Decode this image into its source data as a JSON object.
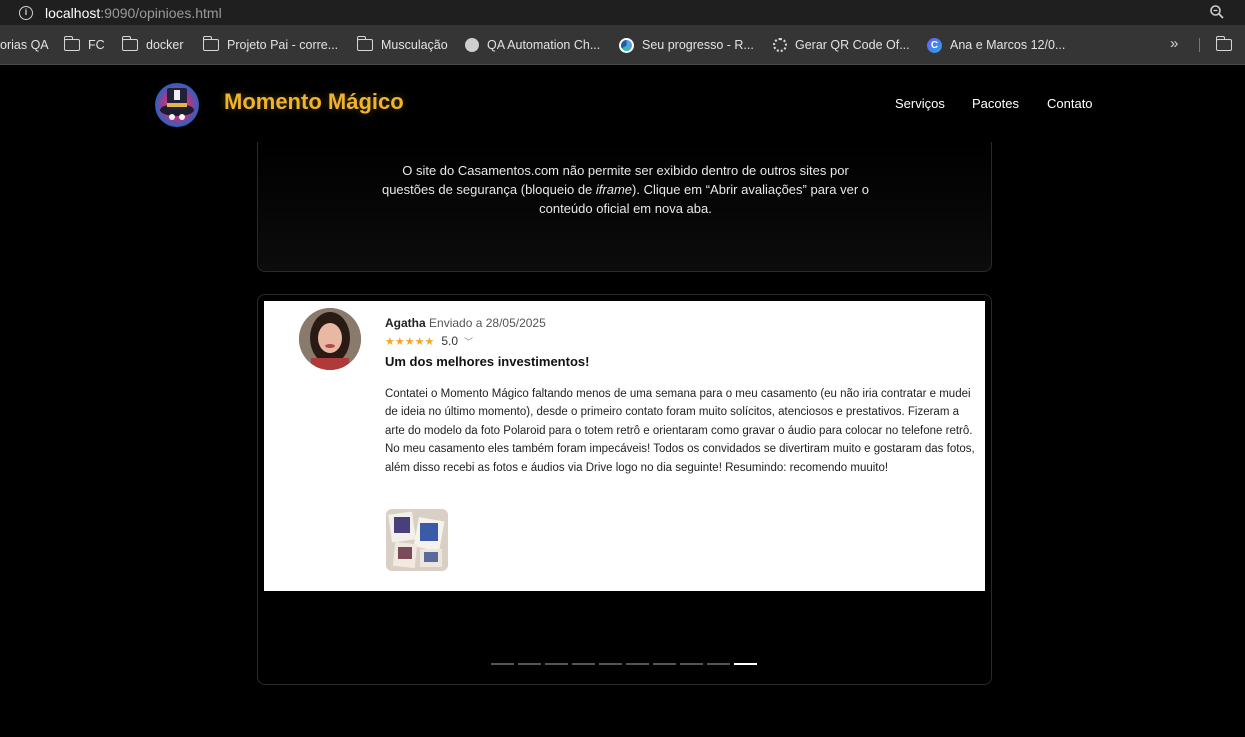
{
  "browser": {
    "url_host": "localhost",
    "url_rest": ":9090/opinioes.html",
    "bookmarks": [
      {
        "label": "orias QA",
        "icon": "none"
      },
      {
        "label": "FC",
        "icon": "folder-icon"
      },
      {
        "label": "docker",
        "icon": "folder-icon"
      },
      {
        "label": "Projeto Pai - corre...",
        "icon": "folder-icon"
      },
      {
        "label": "Musculação",
        "icon": "folder-icon"
      },
      {
        "label": "QA Automation Ch...",
        "icon": "globe-icon"
      },
      {
        "label": "Seu progresso - R...",
        "icon": "app-icon"
      },
      {
        "label": "Gerar QR Code Of...",
        "icon": "gear-icon"
      },
      {
        "label": "Ana e Marcos 12/0...",
        "icon": "c-icon"
      }
    ],
    "more_bookmarks": "»"
  },
  "site": {
    "brand": "Momento Mágico",
    "nav": [
      "Serviços",
      "Pacotes",
      "Contato"
    ]
  },
  "notice": {
    "text_before": "O site do Casamentos.com não permite ser exibido dentro de outros sites por questões de segurança (bloqueio de ",
    "text_em": "iframe",
    "text_after": "). Clique em “Abrir avaliações” para ver o conteúdo oficial em nova aba."
  },
  "review": {
    "author": "Agatha",
    "date": "Enviado a 28/05/2025",
    "stars": "★★★★★",
    "score": "5.0",
    "title": "Um dos melhores investimentos!",
    "paragraph1": "Contatei o Momento Mágico faltando menos de uma semana para o meu casamento (eu não iria contratar e mudei de ideia no último momento), desde o primeiro contato foram muito solícitos, atenciosos e prestativos. Fizeram a arte do modelo da foto Polaroid para o totem retrô e orientaram como gravar o áudio para colocar no telefone retrô.",
    "paragraph2": "No meu casamento eles também foram impecáveis! Todos os convidados se divertiram muito e gostaram das fotos, além disso recebi as fotos e áudios via Drive logo no dia seguinte! Resumindo: recomendo muuito!"
  },
  "carousel": {
    "total_slides": 10,
    "active_index": 9
  },
  "colors": {
    "brand": "#f0b429",
    "stars": "#f5a623",
    "background": "#000000"
  }
}
